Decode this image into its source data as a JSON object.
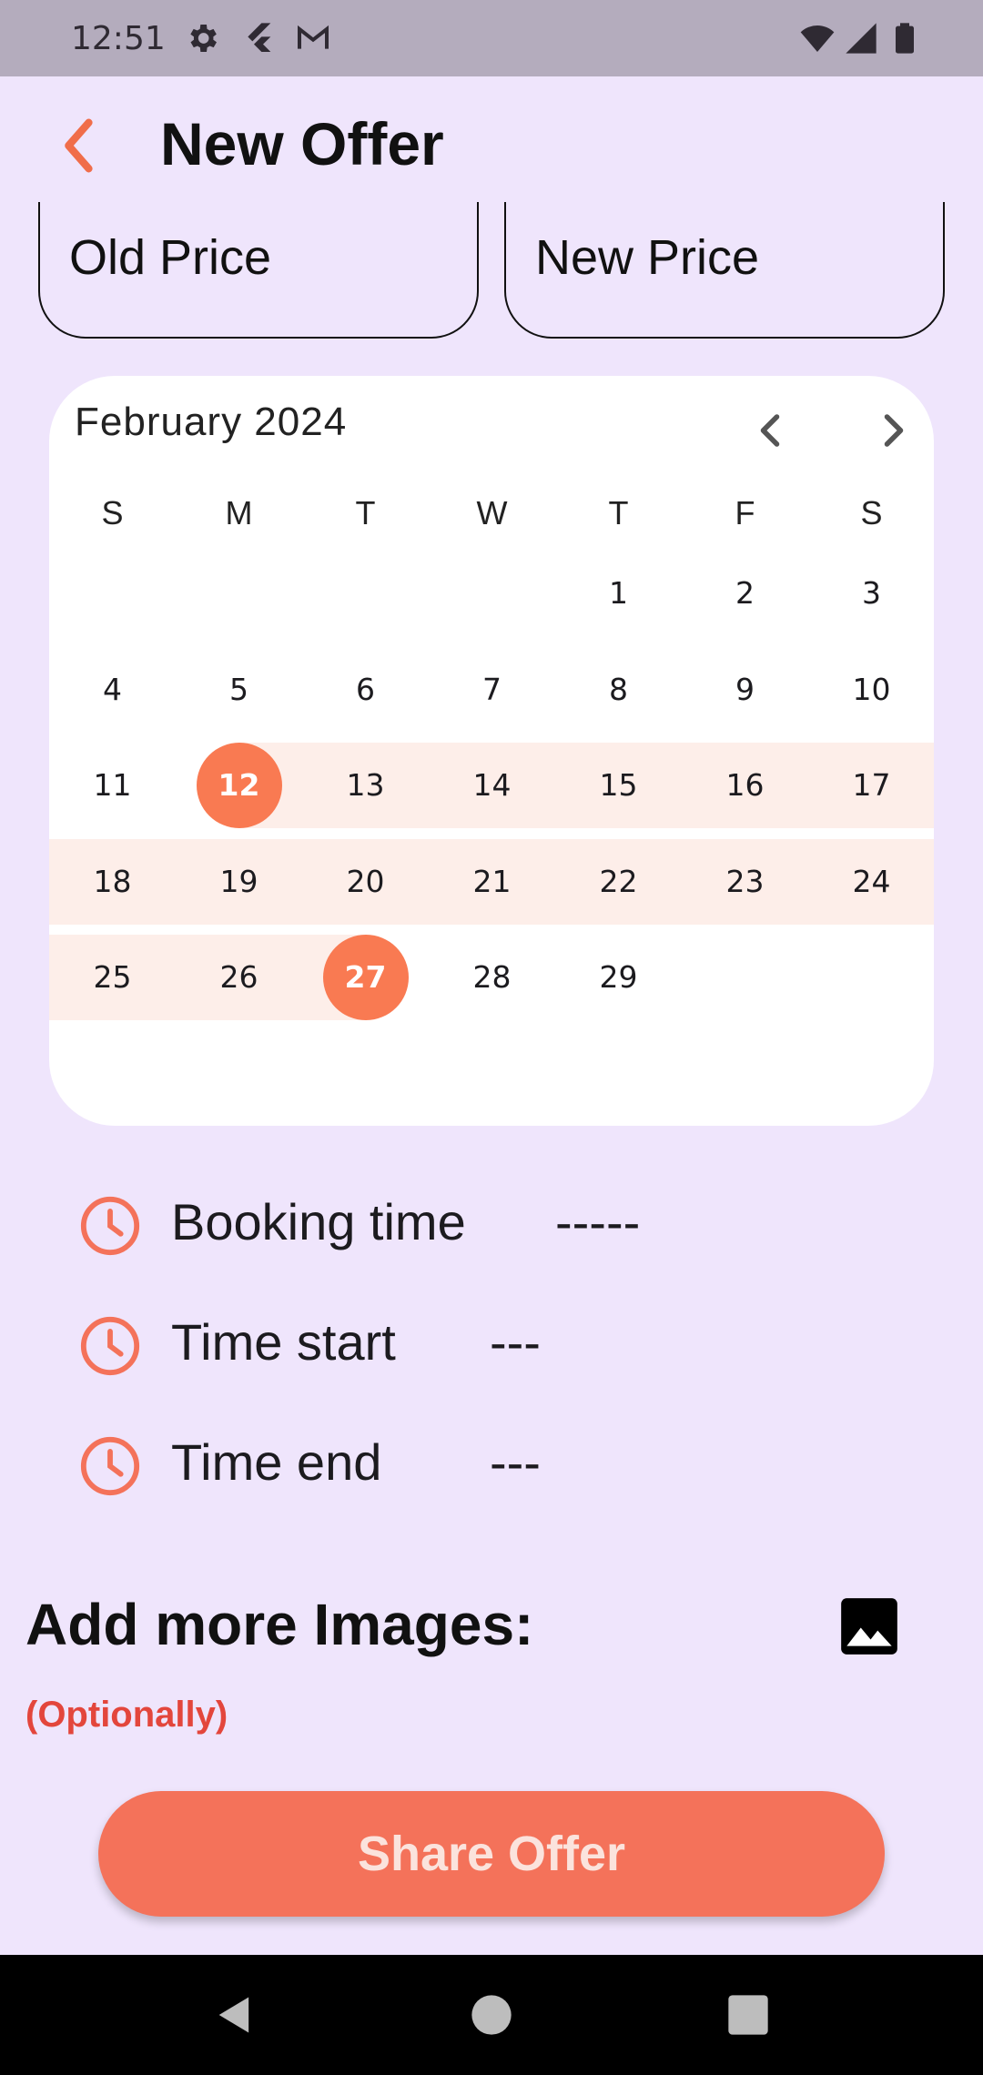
{
  "status_bar": {
    "time": "12:51",
    "icons_left": [
      "gear-icon",
      "flutter-icon",
      "gmail-icon"
    ],
    "icons_right": [
      "wifi-icon",
      "signal-icon",
      "battery-icon"
    ]
  },
  "app_bar": {
    "title": "New Offer",
    "back_icon": "chevron-left-icon"
  },
  "price_fields": {
    "old_placeholder": "Old Price",
    "new_placeholder": "New Price"
  },
  "calendar": {
    "month_label": "February 2024",
    "weekdays": [
      "S",
      "M",
      "T",
      "W",
      "T",
      "F",
      "S"
    ],
    "weeks": [
      [
        "",
        "",
        "",
        "",
        "1",
        "2",
        "3"
      ],
      [
        "4",
        "5",
        "6",
        "7",
        "8",
        "9",
        "10"
      ],
      [
        "11",
        "12",
        "13",
        "14",
        "15",
        "16",
        "17"
      ],
      [
        "18",
        "19",
        "20",
        "21",
        "22",
        "23",
        "24"
      ],
      [
        "25",
        "26",
        "27",
        "28",
        "29",
        "",
        ""
      ]
    ],
    "range_start": "12",
    "range_end": "27"
  },
  "time_rows": [
    {
      "label": "Booking time",
      "value": "-----"
    },
    {
      "label": "Time start",
      "value": "---"
    },
    {
      "label": "Time end",
      "value": "---"
    }
  ],
  "images_section": {
    "heading": "Add more Images:",
    "optional": "(Optionally)",
    "icon": "image-icon"
  },
  "share_button": {
    "label": "Share Offer"
  },
  "colors": {
    "accent": "#f97a52",
    "background": "#efe5fc",
    "range_highlight": "#fdeee9",
    "optional_text": "#e3463c",
    "button": "#f4725a"
  }
}
